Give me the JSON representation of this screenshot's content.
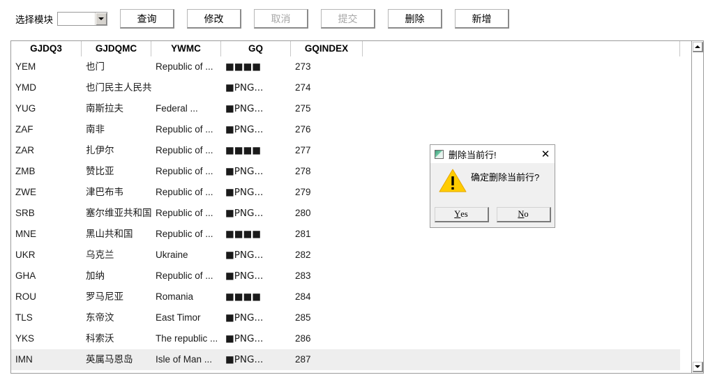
{
  "toolbar": {
    "module_label": "选择模块",
    "module_select": {
      "value": "",
      "placeholder": "",
      "icon": "chevron-down-icon"
    },
    "buttons": [
      {
        "label": "查询",
        "name": "query-button",
        "disabled": false
      },
      {
        "label": "修改",
        "name": "modify-button",
        "disabled": false
      },
      {
        "label": "取消",
        "name": "cancel-button",
        "disabled": true
      },
      {
        "label": "提交",
        "name": "submit-button",
        "disabled": true
      },
      {
        "label": "删除",
        "name": "delete-button",
        "disabled": false
      },
      {
        "label": "新增",
        "name": "add-button",
        "disabled": false
      }
    ]
  },
  "grid": {
    "columns": [
      "GJDQ3",
      "GJDQMC",
      "YWMC",
      "GQ",
      "GQINDEX"
    ],
    "rows": [
      {
        "GJDQ3": "YEM",
        "GJDQMC": "也门",
        "YWMC": "Republic of ...",
        "GQ": "■■■■",
        "GQINDEX": "273",
        "selected": false
      },
      {
        "GJDQ3": "YMD",
        "GJDQMC": "也门民主人民共...",
        "YWMC": "",
        "GQ": "■PNG...",
        "GQINDEX": "274",
        "selected": false
      },
      {
        "GJDQ3": "YUG",
        "GJDQMC": "南斯拉夫",
        "YWMC": "Federal ...",
        "GQ": "■PNG...",
        "GQINDEX": "275",
        "selected": false
      },
      {
        "GJDQ3": "ZAF",
        "GJDQMC": "南非",
        "YWMC": "Republic of ...",
        "GQ": "■PNG...",
        "GQINDEX": "276",
        "selected": false
      },
      {
        "GJDQ3": "ZAR",
        "GJDQMC": "扎伊尔",
        "YWMC": "Republic of ...",
        "GQ": "■■■■",
        "GQINDEX": "277",
        "selected": false
      },
      {
        "GJDQ3": "ZMB",
        "GJDQMC": "赞比亚",
        "YWMC": "Republic of ...",
        "GQ": "■PNG...",
        "GQINDEX": "278",
        "selected": false
      },
      {
        "GJDQ3": "ZWE",
        "GJDQMC": "津巴布韦",
        "YWMC": "Republic of ...",
        "GQ": "■PNG...",
        "GQINDEX": "279",
        "selected": false
      },
      {
        "GJDQ3": "SRB",
        "GJDQMC": "塞尔维亚共和国",
        "YWMC": "Republic of ...",
        "GQ": "■PNG...",
        "GQINDEX": "280",
        "selected": false
      },
      {
        "GJDQ3": "MNE",
        "GJDQMC": "黑山共和国",
        "YWMC": "Republic of ...",
        "GQ": "■■■■",
        "GQINDEX": "281",
        "selected": false
      },
      {
        "GJDQ3": "UKR",
        "GJDQMC": "乌克兰",
        "YWMC": "Ukraine",
        "GQ": "■PNG...",
        "GQINDEX": "282",
        "selected": false
      },
      {
        "GJDQ3": "GHA",
        "GJDQMC": "加纳",
        "YWMC": "Republic of ...",
        "GQ": "■PNG...",
        "GQINDEX": "283",
        "selected": false
      },
      {
        "GJDQ3": "ROU",
        "GJDQMC": "罗马尼亚",
        "YWMC": "Romania",
        "GQ": "■■■■",
        "GQINDEX": "284",
        "selected": false
      },
      {
        "GJDQ3": "TLS",
        "GJDQMC": "东帝汶",
        "YWMC": "East Timor",
        "GQ": "■PNG...",
        "GQINDEX": "285",
        "selected": false
      },
      {
        "GJDQ3": "YKS",
        "GJDQMC": "科索沃",
        "YWMC": "The  republic ...",
        "GQ": "■PNG...",
        "GQINDEX": "286",
        "selected": false
      },
      {
        "GJDQ3": "IMN",
        "GJDQMC": "英属马恩岛",
        "YWMC": "Isle of Man ...",
        "GQ": "■PNG...",
        "GQINDEX": "287",
        "selected": true
      }
    ],
    "scrollbar": {
      "up_icon": "triangle-up-icon",
      "down_icon": "triangle-down-icon"
    }
  },
  "dialog": {
    "title": "删除当前行!",
    "title_icon": "app-icon",
    "close_icon": "close-icon",
    "warning_icon": "warning-triangle-icon",
    "message": "确定删除当前行?",
    "yes_mnemonic": "Y",
    "yes_rest": "es",
    "no_mnemonic": "N",
    "no_rest": "o"
  },
  "colors": {
    "selected_row": "#eeeeee",
    "warning": "#ffcc00",
    "dialog_bg": "#f0f0f0",
    "disabled_text": "#a6a6a6"
  }
}
